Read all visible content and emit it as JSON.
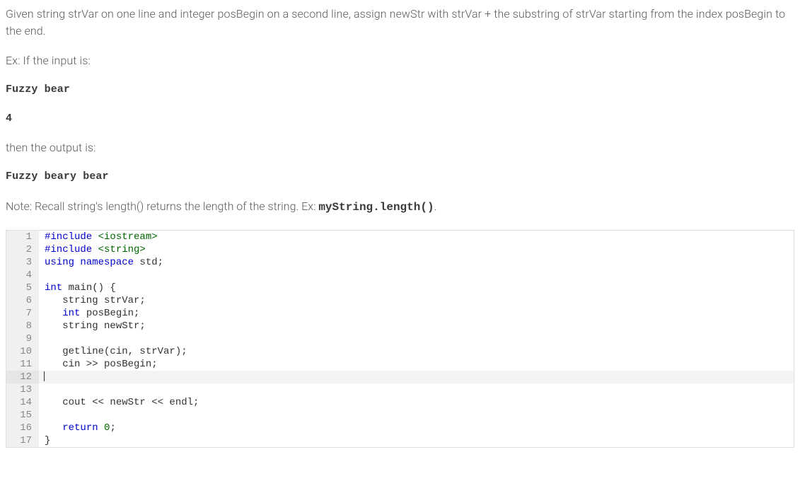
{
  "problem": {
    "description": "Given string strVar on one line and integer posBegin on a second line, assign newStr with strVar + the substring of strVar starting from the index posBegin to the end.",
    "example_intro": "Ex: If the input is:",
    "example_input_line1": "Fuzzy bear",
    "example_input_line2": "4",
    "output_intro": "then the output is:",
    "example_output": "Fuzzy beary bear",
    "note_prefix": "Note: Recall string's length() returns the length of the string. Ex: ",
    "note_code": "myString.length()",
    "note_suffix": "."
  },
  "code": {
    "active_line": 12,
    "lines": [
      {
        "n": 1,
        "tokens": [
          [
            "#include ",
            "kw"
          ],
          [
            "<iostream>",
            "str"
          ]
        ]
      },
      {
        "n": 2,
        "tokens": [
          [
            "#include ",
            "kw"
          ],
          [
            "<string>",
            "str"
          ]
        ]
      },
      {
        "n": 3,
        "tokens": [
          [
            "using",
            "kw"
          ],
          [
            " ",
            ""
          ],
          [
            "namespace",
            "kw"
          ],
          [
            " std;",
            ""
          ]
        ]
      },
      {
        "n": 4,
        "tokens": []
      },
      {
        "n": 5,
        "tokens": [
          [
            "int",
            "typekw"
          ],
          [
            " main() {",
            ""
          ]
        ]
      },
      {
        "n": 6,
        "tokens": [
          [
            "   string strVar;",
            ""
          ]
        ]
      },
      {
        "n": 7,
        "tokens": [
          [
            "   ",
            ""
          ],
          [
            "int",
            "typekw"
          ],
          [
            " posBegin;",
            ""
          ]
        ]
      },
      {
        "n": 8,
        "tokens": [
          [
            "   string newStr;",
            ""
          ]
        ]
      },
      {
        "n": 9,
        "tokens": []
      },
      {
        "n": 10,
        "tokens": [
          [
            "   getline(cin, strVar);",
            ""
          ]
        ]
      },
      {
        "n": 11,
        "tokens": [
          [
            "   cin >> posBegin;",
            ""
          ]
        ]
      },
      {
        "n": 12,
        "tokens": []
      },
      {
        "n": 13,
        "tokens": []
      },
      {
        "n": 14,
        "tokens": [
          [
            "   cout << newStr << endl;",
            ""
          ]
        ]
      },
      {
        "n": 15,
        "tokens": []
      },
      {
        "n": 16,
        "tokens": [
          [
            "   ",
            ""
          ],
          [
            "return",
            "kw"
          ],
          [
            " ",
            ""
          ],
          [
            "0",
            "num"
          ],
          [
            ";",
            ""
          ]
        ]
      },
      {
        "n": 17,
        "tokens": [
          [
            "}",
            ""
          ]
        ]
      }
    ]
  }
}
